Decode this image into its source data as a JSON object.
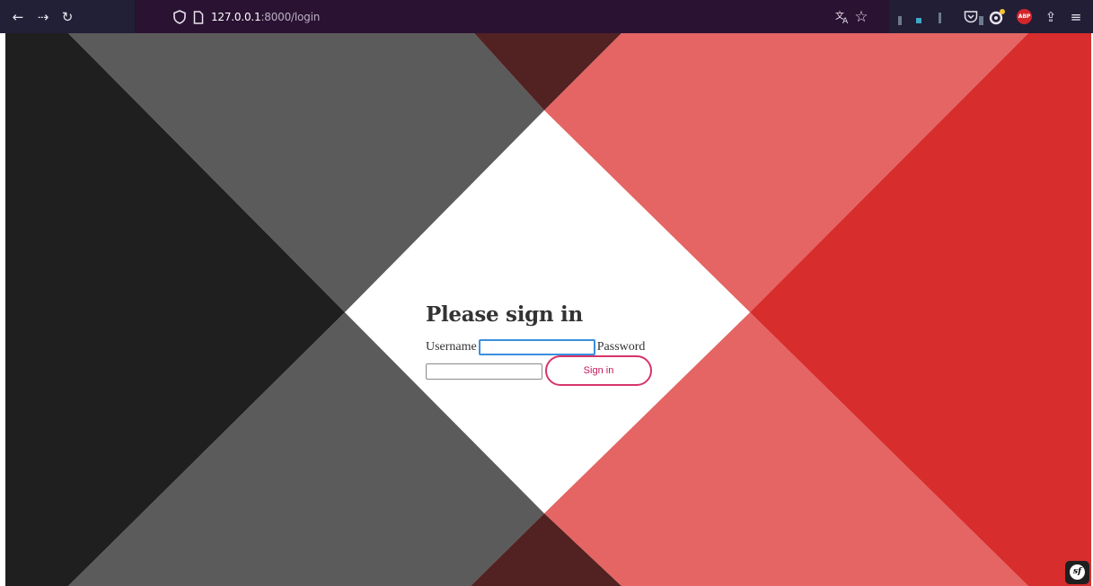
{
  "browser": {
    "url_host": "127.0.0.1",
    "url_path": ":8000/login",
    "abp_label": "ABP"
  },
  "page": {
    "heading": "Please sign in",
    "username_label": "Username",
    "password_label": "Password",
    "username_value": "",
    "password_value": "",
    "signin_label": "Sign in"
  },
  "colors": {
    "accent": "#d8336a",
    "dark": "#1f1f1f",
    "gray": "#5b5b5b",
    "red": "#d82d2d",
    "light_red": "#e46563",
    "maroon": "#522222"
  },
  "icons": [
    "back-arrow-icon",
    "forward-arrow-icon",
    "reload-icon",
    "shield-icon",
    "page-icon",
    "translate-icon",
    "bookmark-star-icon",
    "pocket-icon",
    "extension-icon",
    "adblock-plus-icon",
    "share-icon",
    "menu-icon",
    "symfony-icon"
  ]
}
